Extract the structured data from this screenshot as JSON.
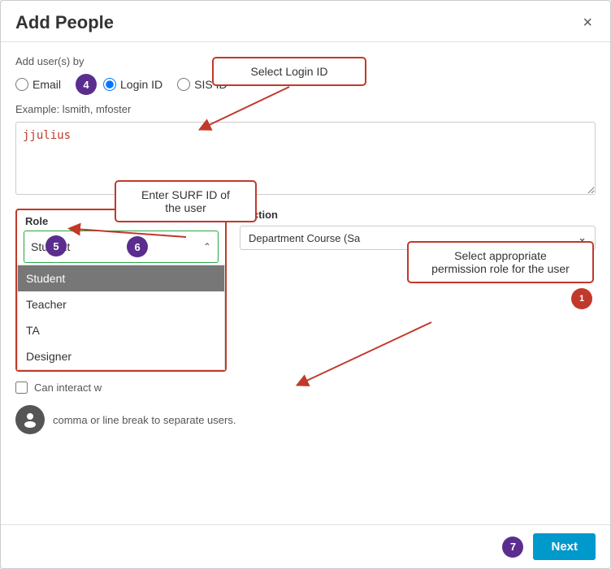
{
  "modal": {
    "title": "Add People",
    "close_label": "×"
  },
  "add_users_by": {
    "label": "Add user(s) by",
    "options": [
      "Email",
      "Login ID",
      "SIS ID"
    ],
    "selected": "Login ID"
  },
  "example_text": "Example: lsmith, mfoster",
  "user_input_value": "jjulius",
  "role_section": {
    "role_label": "Role",
    "selected_role": "Student",
    "roles": [
      "Student",
      "Teacher",
      "TA",
      "Designer"
    ],
    "section_label": "ection",
    "section_value": "Department Course (Sa"
  },
  "can_interact_label": "Can interact w",
  "separator_text": "comma or line break to separate users.",
  "footer": {
    "next_label": "Next"
  },
  "callouts": {
    "select_login_id": "Select Login ID",
    "enter_surf_id": "Enter SURF ID of\nthe user",
    "select_permission": "Select appropriate\npermission role for the user"
  },
  "steps": {
    "step4": "4",
    "step5": "5",
    "step6": "6",
    "step7": "7"
  },
  "badges": {
    "step1": "1"
  }
}
